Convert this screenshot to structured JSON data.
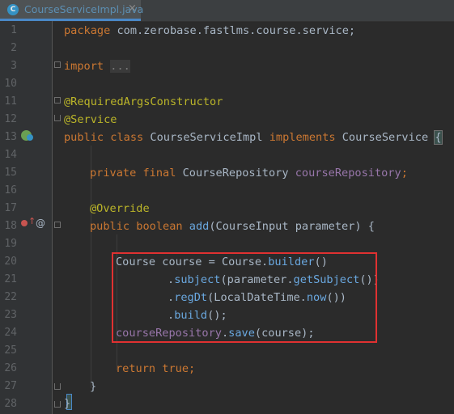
{
  "tab": {
    "icon_letter": "C",
    "filename": "CourseServiceImpl.java",
    "close": "×"
  },
  "gutter_numbers": [
    "1",
    "2",
    "3",
    "10",
    "11",
    "12",
    "13",
    "14",
    "15",
    "16",
    "17",
    "18",
    "19",
    "20",
    "21",
    "22",
    "23",
    "24",
    "25",
    "26",
    "27",
    "28"
  ],
  "code": {
    "l1_kw": "package",
    "l1_rest": " com.zerobase.fastlms.course.service;",
    "l3_kw": "import",
    "l3_rest": "...",
    "l11": "@RequiredArgsConstructor",
    "l12": "@Service",
    "l13_kw": "public class",
    "l13_a": " CourseServiceImpl ",
    "l13_kw2": "implements",
    "l13_b": " CourseService ",
    "l13_brace": "{",
    "l15_kw": "private final",
    "l15_a": " CourseRepository ",
    "l15_fld": "courseRepository",
    "l15_end": ";",
    "l17": "@Override",
    "l18_kw": "public boolean",
    "l18_sp": " ",
    "l18_m": "add",
    "l18_rest": "(CourseInput parameter) {",
    "l20_a": "Course course = Course.",
    "l20_m": "builder",
    "l20_end": "()",
    "l21_dot": ".",
    "l21_m": "subject",
    "l21_a": "(parameter.",
    "l21_m2": "getSubject",
    "l21_end": "())",
    "l22_dot": ".",
    "l22_m": "regDt",
    "l22_a": "(LocalDateTime.",
    "l22_m2": "now",
    "l22_end": "())",
    "l23_dot": ".",
    "l23_m": "build",
    "l23_end": "();",
    "l24_fld": "courseRepository",
    "l24_dot": ".",
    "l24_m": "save",
    "l24_end": "(course);",
    "l26_kw": "return true",
    "l26_end": ";",
    "l27": "}",
    "l28": "}"
  }
}
